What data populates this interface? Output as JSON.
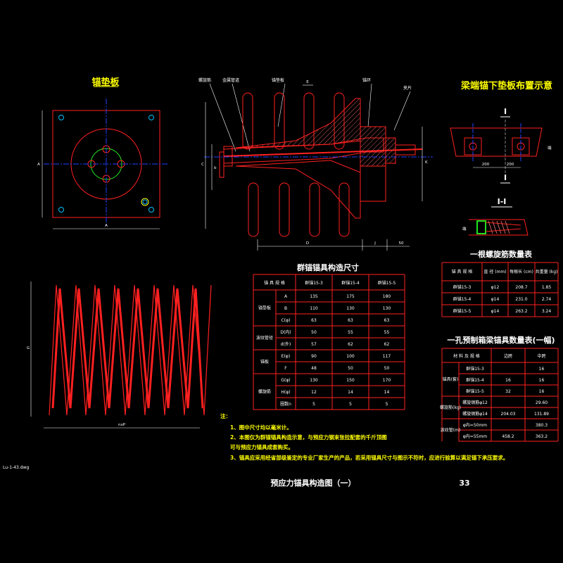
{
  "titles": {
    "anchor_plate": "锚垫板",
    "plate_layout": "梁端锚下垫板布置示意",
    "section_mark": "I",
    "section_label": "I-I",
    "structure_table": "群锚锚具构造尺寸",
    "spiral_table": "一根螺旋筋数量表",
    "anchor_qty_table": "一孔预制箱梁锚具数量表(一幅)",
    "drawing": "预应力锚具构造图（一）",
    "page_number": "33",
    "corner_tag": "Lu-1-43.dwg"
  },
  "labels": {
    "spiral": "螺旋筋",
    "bellows": "金属管道",
    "plate": "锚垫板",
    "anchor": "锚环",
    "clip": "夹片",
    "dim_a": "A",
    "dim_b": "B",
    "dim_c": "C",
    "dim_d": "D",
    "dim_e": "E",
    "dim_g": "G",
    "dim_j": "J",
    "dim_k": "K",
    "dim_h": "H",
    "dim_b1": "b",
    "dim_50": "50",
    "dim_200a": "200",
    "dim_200b": "200",
    "dim_side": "端",
    "dim_sec": "端",
    "coil_len": "nxP"
  },
  "structure_table": {
    "headers": [
      "锚 具 规 格",
      "群锚15-3",
      "群锚15-4",
      "群锚15-5"
    ],
    "groups": [
      "锚垫板",
      "波纹管径",
      "锚板",
      "螺旋筋"
    ],
    "rows": [
      [
        "A",
        "135",
        "175",
        "180"
      ],
      [
        "B",
        "110",
        "130",
        "130"
      ],
      [
        "C(φ)",
        "63",
        "63",
        "63"
      ],
      [
        "D(内)",
        "50",
        "55",
        "55"
      ],
      [
        "d(外)",
        "57",
        "62",
        "62"
      ],
      [
        "E(φ)",
        "90",
        "100",
        "117"
      ],
      [
        "F",
        "48",
        "50",
        "50"
      ],
      [
        "G(φ)",
        "130",
        "150",
        "170"
      ],
      [
        "H(φ)",
        "12",
        "14",
        "14"
      ],
      [
        "圈数n",
        "5",
        "5",
        "5"
      ]
    ]
  },
  "spiral_table": {
    "headers": [
      "锚 具 规 格",
      "直 径 (mm)",
      "每根长 (cm)",
      "共重量 (kg)"
    ],
    "rows": [
      [
        "群锚15-3",
        "φ12",
        "208.7",
        "1.85"
      ],
      [
        "群锚15-4",
        "φ14",
        "231.0",
        "2.74"
      ],
      [
        "群锚15-5",
        "φ14",
        "263.2",
        "3.24"
      ]
    ]
  },
  "qty_table": {
    "headers": [
      "材 料 及 规 格",
      "边跨",
      "中跨"
    ],
    "groups": [
      "锚具(套)",
      "螺旋筋(kg)",
      "波纹管(m)"
    ],
    "rows": [
      [
        "群锚15-3",
        "",
        "16"
      ],
      [
        "群锚15-4",
        "16",
        "16"
      ],
      [
        "群锚15-5",
        "32",
        "16"
      ],
      [
        "螺旋钢筋φ12",
        "",
        "29.60"
      ],
      [
        "螺旋钢筋φ14",
        "204.03",
        "131.89"
      ],
      [
        "φ内=50mm",
        "",
        "380.3"
      ],
      [
        "φ内=55mm",
        "458.2",
        "363.2"
      ]
    ]
  },
  "notes": [
    "注：",
    "1、图中尺寸均以毫米计。",
    "2、本图仅为群锚锚具构造示意，与预应力钢束张拉配套的千斤顶图",
    "   可与预应力锚具成套购买。",
    "3、锚具应采用经省部级鉴定的专业厂家生产的产品，若采用锚具尺寸与图示不符时，应进行验算以满足锚下承压要求。"
  ],
  "colors": {
    "line": "#ff2020",
    "accent": "#ffff00",
    "center": "#2040ff",
    "hole": "#00c0ff",
    "ring": "#20e020",
    "hatch": "#d06060"
  }
}
